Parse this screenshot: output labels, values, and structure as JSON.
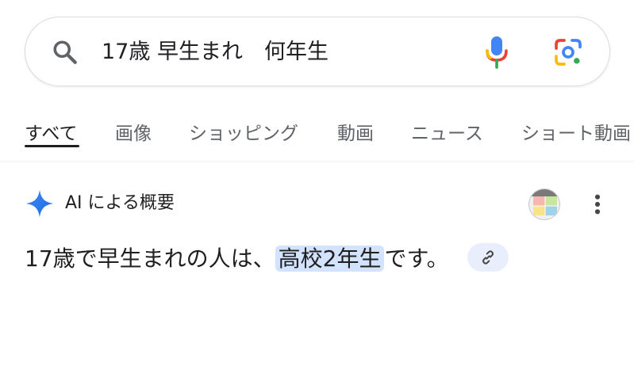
{
  "search": {
    "query": "17歳 早生まれ　何年生"
  },
  "icons": {
    "search": "search-icon",
    "voice": "microphone-icon",
    "lens": "google-lens-icon",
    "ai": "gemini-sparkle-icon",
    "more": "more-vert-icon",
    "link": "link-icon"
  },
  "tabs": [
    {
      "label": "すべて",
      "active": true
    },
    {
      "label": "画像"
    },
    {
      "label": "ショッピング"
    },
    {
      "label": "動画"
    },
    {
      "label": "ニュース"
    },
    {
      "label": "ショート動画"
    }
  ],
  "ai_overview": {
    "title": "AI による概要",
    "answer_prefix": "17歳で早生まれの人は、",
    "answer_highlight": "高校2年生",
    "answer_suffix": "です。"
  },
  "colors": {
    "accent_blue": "#1a73e8",
    "highlight": "#d3e3fd",
    "text_primary": "#1f1f1f",
    "text_secondary": "#5f6368"
  }
}
